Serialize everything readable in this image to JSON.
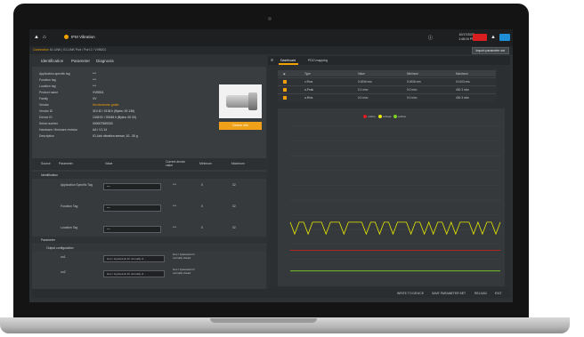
{
  "colors": {
    "accent": "#f2a200",
    "red": "#d81e1e",
    "yellow": "#e7e900",
    "green": "#7ed321",
    "blue": "#1f8fd8"
  },
  "header": {
    "device_name": "IFM Vibration",
    "clock_date": "10/17/2020",
    "clock_time": "1:48:16 PM"
  },
  "pathbar": {
    "prefix": "Connection",
    "path": "IO-LINK | IO-LINK Port / Port 2 / VVB001",
    "report_button": "Import parameter set"
  },
  "left_tabs": [
    "Identification",
    "Parameter",
    "Diagnosis"
  ],
  "identification": [
    {
      "label": "Application-specific tag",
      "value": "***"
    },
    {
      "label": "Function tag",
      "value": "***"
    },
    {
      "label": "Location tag",
      "value": "***"
    },
    {
      "label": "Product name",
      "value": "VVB001"
    },
    {
      "label": "Family",
      "value": "VV"
    },
    {
      "label": "Vendor",
      "value": "ifm electronic gmbh"
    },
    {
      "label": "Vendor ID",
      "value": "310 ID / 0136 h (Bytes: 00 136)"
    },
    {
      "label": "Device ID",
      "value": "1348 ID / 00348 h (Bytes: 00 00)"
    },
    {
      "label": "Serial number",
      "value": "000007569333"
    },
    {
      "label": "Hardware / firmware revision",
      "value": "AA / V1.14"
    },
    {
      "label": "Description",
      "value": "IO-Link vibration sensor, 10...30 g"
    }
  ],
  "product_button": "Device info",
  "param_table": {
    "headers": [
      "Source",
      "Parameter",
      "Value",
      "Current device value",
      "Minimum",
      "Maximum"
    ],
    "sections": [
      "Identification",
      "Parameter",
      "Output configuration"
    ],
    "rows": [
      {
        "name": "Application Specific Tag",
        "value": "***",
        "current": "***",
        "min": "0",
        "max": "32"
      },
      {
        "name": "Function Tag",
        "value": "***",
        "current": "***",
        "min": "0",
        "max": "32"
      },
      {
        "name": "Location Tag",
        "value": "***",
        "current": "***",
        "min": "0",
        "max": "32"
      },
      {
        "name": "ou1",
        "value": "Hno / Hysteresis fct normally cl...",
        "current": "Hno / hysteresis fct normally closed",
        "min": "",
        "max": ""
      },
      {
        "name": "ou2",
        "value": "Hno / Hysteresis fct normally cl...",
        "current": "Hno / hysteresis fct normally closed",
        "min": "",
        "max": ""
      }
    ]
  },
  "footer": {
    "write": "WRITE TO DEVICE",
    "save": "SAVE PARAMETER SET",
    "reload": "RELOAD",
    "exit": "EXIT"
  },
  "right_tabs": [
    "Dashboard",
    "PDO mapping"
  ],
  "measure_table": {
    "headers": [
      "Type",
      "Value",
      "Minimum",
      "Maximum"
    ],
    "rows": [
      {
        "type": "v-Rms",
        "value": "0.0006 m/s",
        "min": "0.0006 m/s",
        "max": "0.0103 m/s"
      },
      {
        "type": "a-Peak",
        "value": "0.1 m/s²",
        "min": "0.0 m/s²",
        "max": "400.3 m/s²"
      },
      {
        "type": "a-Rms",
        "value": "0.0 m/s²",
        "min": "0.0 m/s²",
        "max": "400.3 m/s²"
      }
    ]
  },
  "chart_data": {
    "type": "line",
    "legend_items": [
      "v-Rms",
      "a-Peak",
      "a-Rms"
    ],
    "series": [
      {
        "name": "v-Rms",
        "color": "#e7e900",
        "values": [
          0.35,
          0.27,
          0.35,
          0.35,
          0.27,
          0.35,
          0.35,
          0.35,
          0.27,
          0.35,
          0.35,
          0.35,
          0.27,
          0.35,
          0.35,
          0.35,
          0.35,
          0.27,
          0.35,
          0.35,
          0.27,
          0.35,
          0.35,
          0.27,
          0.35,
          0.35,
          0.35,
          0.27,
          0.35,
          0.35,
          0.27,
          0.35,
          0.27,
          0.35,
          0.35,
          0.27,
          0.35,
          0.27,
          0.35,
          0.35,
          0.35,
          0.27,
          0.35,
          0.27,
          0.35,
          0.35,
          0.27,
          0.35
        ]
      },
      {
        "name": "a-Peak",
        "color": "#d81e1e",
        "values": [
          0.16,
          0.16,
          0.16,
          0.16,
          0.16,
          0.16,
          0.16,
          0.16,
          0.16,
          0.16,
          0.16,
          0.16,
          0.16,
          0.16,
          0.16,
          0.16,
          0.16,
          0.16,
          0.16,
          0.16,
          0.16,
          0.16,
          0.16,
          0.16,
          0.16,
          0.16,
          0.16,
          0.16,
          0.16,
          0.16,
          0.16,
          0.16,
          0.16,
          0.16,
          0.16,
          0.16,
          0.16,
          0.16,
          0.16,
          0.16,
          0.16,
          0.16,
          0.16,
          0.16,
          0.16,
          0.16,
          0.16,
          0.16
        ]
      },
      {
        "name": "a-Rms",
        "color": "#7ed321",
        "values": [
          0.02,
          0.02,
          0.02,
          0.02,
          0.02,
          0.02,
          0.02,
          0.02,
          0.02,
          0.02,
          0.02,
          0.02,
          0.02,
          0.02,
          0.02,
          0.02,
          0.02,
          0.02,
          0.02,
          0.02,
          0.02,
          0.02,
          0.02,
          0.02,
          0.02,
          0.02,
          0.02,
          0.02,
          0.02,
          0.02,
          0.02,
          0.02,
          0.02,
          0.02,
          0.02,
          0.02,
          0.02,
          0.02,
          0.02,
          0.02,
          0.02,
          0.02,
          0.02,
          0.02,
          0.02,
          0.02,
          0.02,
          0.02
        ]
      }
    ],
    "ylim": [
      0,
      1
    ],
    "grid": true,
    "legend_position": "top-center"
  }
}
